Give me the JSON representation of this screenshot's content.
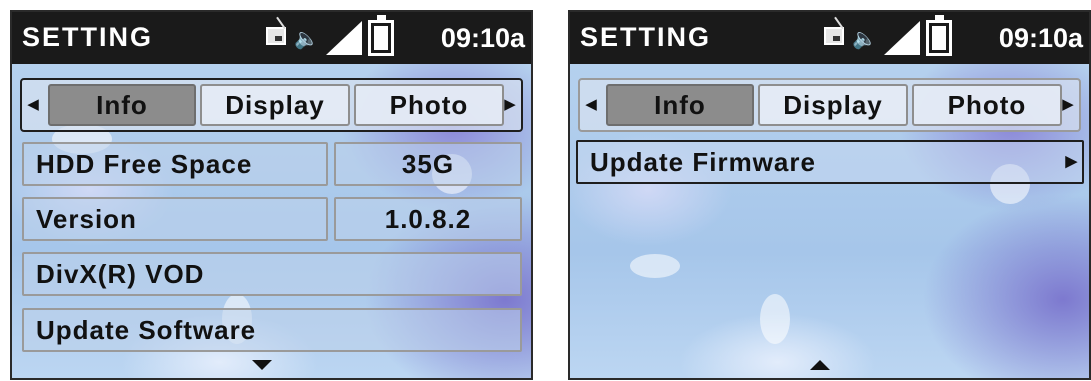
{
  "screens": [
    {
      "status": {
        "title": "SETTING",
        "time": "09:10a",
        "icons": [
          "photo-icon",
          "speaker-icon",
          "signal-icon",
          "battery-icon"
        ]
      },
      "tabs": [
        {
          "label": "Info",
          "active": true
        },
        {
          "label": "Display",
          "active": false
        },
        {
          "label": "Photo",
          "active": false
        }
      ],
      "rows": [
        {
          "label": "HDD Free Space",
          "value": "35G"
        },
        {
          "label": "Version",
          "value": "1.0.8.2"
        },
        {
          "label": "DivX(R) VOD"
        },
        {
          "label": "Update Software"
        }
      ],
      "scroll_indicator": "down"
    },
    {
      "status": {
        "title": "SETTING",
        "time": "09:10a",
        "icons": [
          "photo-icon",
          "speaker-icon",
          "signal-icon",
          "battery-icon"
        ]
      },
      "tabs": [
        {
          "label": "Info",
          "active": true
        },
        {
          "label": "Display",
          "active": false
        },
        {
          "label": "Photo",
          "active": false
        }
      ],
      "rows": [
        {
          "label": "Update Firmware",
          "selected": true
        }
      ],
      "scroll_indicator": "up"
    }
  ]
}
